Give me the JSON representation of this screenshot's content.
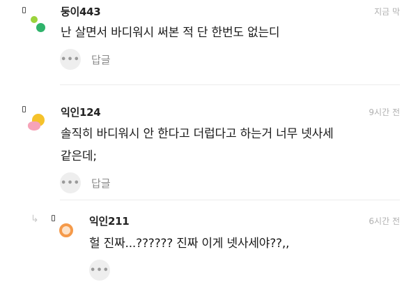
{
  "comments": [
    {
      "author": "둥이443",
      "time": "지금 막",
      "lines": [
        "난 살면서 바디워시 써본 적 단 한번도 없는디"
      ],
      "more_label": "•••",
      "reply_label": "답글"
    },
    {
      "author": "익인124",
      "time": "9시간 전",
      "lines": [
        "솔직히 바디워시 안 한다고 더럽다고 하는거 너무 넷사세",
        "같은데;"
      ],
      "more_label": "•••",
      "reply_label": "답글"
    }
  ],
  "reply": {
    "author": "익인211",
    "time": "6시간 전",
    "lines": [
      "헐 진짜...?????? 진짜 이게 넷사세야??,,"
    ],
    "more_label": "•••",
    "arrow_icon": "reply-arrow-icon"
  },
  "colors": {
    "green_light": "#9bd33c",
    "green_dark": "#2fb36b",
    "yellow": "#f5c22b",
    "pink": "#f6a3b8",
    "orange": "#f59a4a"
  }
}
